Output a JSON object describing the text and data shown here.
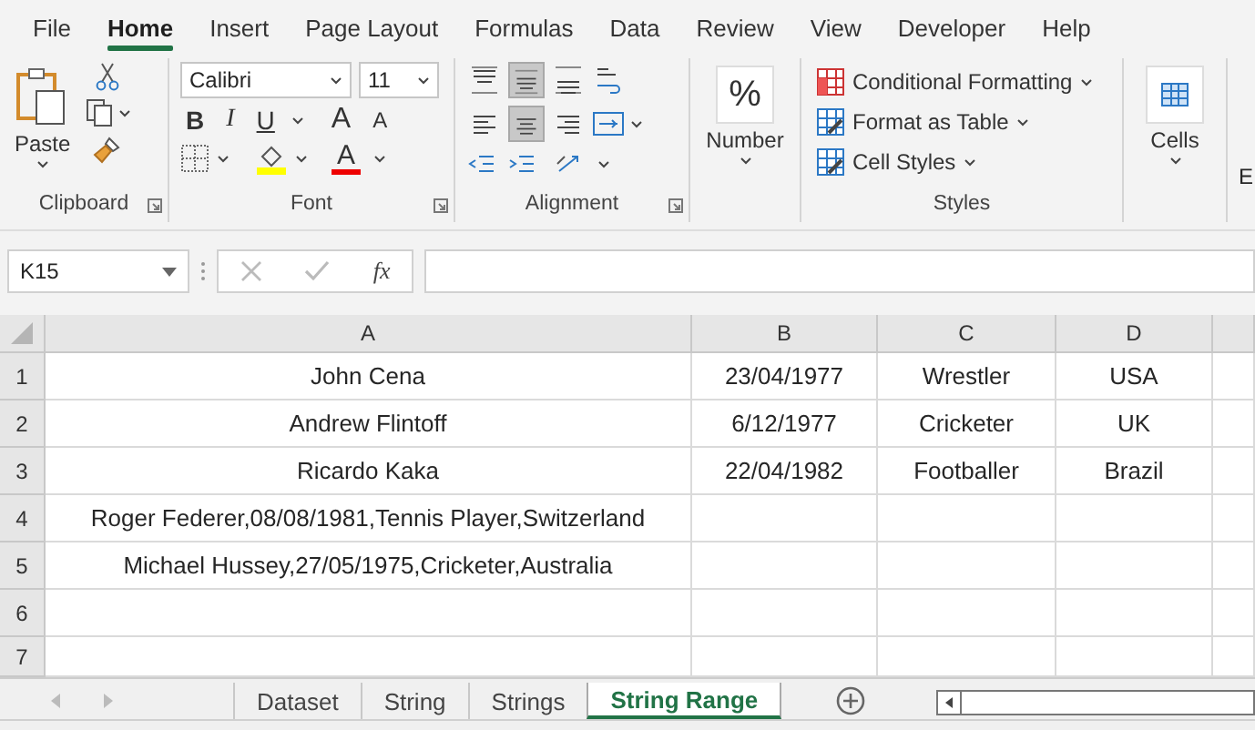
{
  "menu_tabs": [
    {
      "label": "File",
      "selected": false
    },
    {
      "label": "Home",
      "selected": true
    },
    {
      "label": "Insert",
      "selected": false
    },
    {
      "label": "Page Layout",
      "selected": false
    },
    {
      "label": "Formulas",
      "selected": false
    },
    {
      "label": "Data",
      "selected": false
    },
    {
      "label": "Review",
      "selected": false
    },
    {
      "label": "View",
      "selected": false
    },
    {
      "label": "Developer",
      "selected": false
    },
    {
      "label": "Help",
      "selected": false
    }
  ],
  "clipboard": {
    "paste_label": "Paste",
    "group_label": "Clipboard"
  },
  "font": {
    "font_name": "Calibri",
    "font_size": "11",
    "bold": "B",
    "italic": "I",
    "underline": "U",
    "grow": "A",
    "shrink": "A",
    "font_color": "A",
    "group_label": "Font"
  },
  "alignment": {
    "vertical_buttons": [
      {
        "selected": false
      },
      {
        "selected": true
      },
      {
        "selected": false
      }
    ],
    "horizontal_buttons": [
      {
        "selected": false
      },
      {
        "selected": true
      },
      {
        "selected": false
      }
    ],
    "group_label": "Alignment"
  },
  "number": {
    "symbol": "%",
    "label": "Number"
  },
  "styles": {
    "items": [
      "Conditional Formatting",
      "Format as Table",
      "Cell Styles"
    ],
    "group_label": "Styles"
  },
  "cells": {
    "label": "Cells"
  },
  "editing": {
    "label": "E"
  },
  "name_box": "K15",
  "fx": "fx",
  "columns": [
    "A",
    "B",
    "C",
    "D"
  ],
  "rows": [
    {
      "number": "1",
      "cells": [
        "John Cena",
        "23/04/1977",
        "Wrestler",
        "USA"
      ]
    },
    {
      "number": "2",
      "cells": [
        "Andrew Flintoff",
        "6/12/1977",
        "Cricketer",
        "UK"
      ]
    },
    {
      "number": "3",
      "cells": [
        "Ricardo Kaka",
        "22/04/1982",
        "Footballer",
        "Brazil"
      ]
    },
    {
      "number": "4",
      "cells": [
        "Roger Federer,08/08/1981,Tennis Player,Switzerland"
      ]
    },
    {
      "number": "5",
      "cells": [
        "Michael Hussey,27/05/1975,Cricketer,Australia"
      ]
    },
    {
      "number": "6",
      "cells": []
    },
    {
      "number": "7",
      "cells": []
    }
  ],
  "sheet_tabs": [
    {
      "label": "Dataset",
      "selected": false
    },
    {
      "label": "String",
      "selected": false
    },
    {
      "label": "Strings",
      "selected": false
    },
    {
      "label": "String Range",
      "selected": true
    }
  ]
}
